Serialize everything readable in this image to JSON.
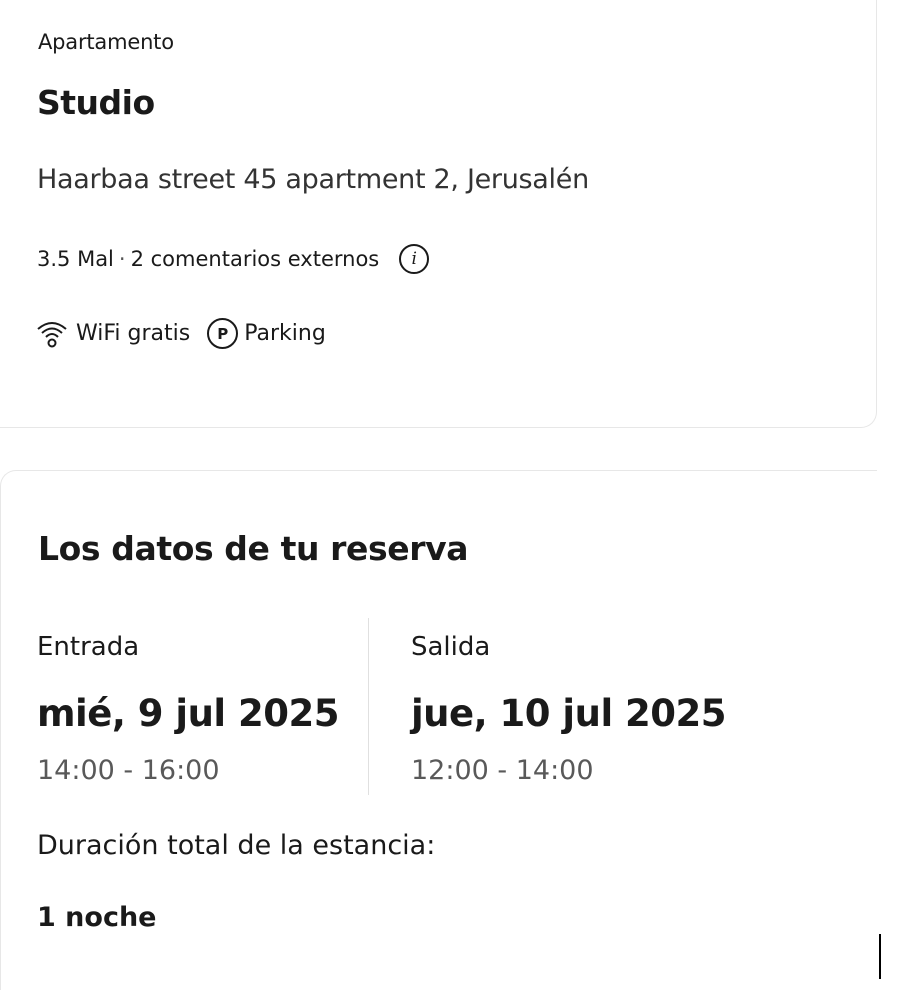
{
  "property": {
    "type": "Apartamento",
    "name": "Studio",
    "address": "Haarbaa street 45 apartment 2, Jerusalén",
    "rating": "3.5 Mal",
    "separator": "·",
    "reviews": "2 comentarios externos",
    "info_icon": "i",
    "facilities": [
      {
        "icon": "wifi-icon",
        "label": "WiFi gratis"
      },
      {
        "icon": "parking-icon",
        "glyph": "P",
        "label": "Parking"
      }
    ]
  },
  "booking": {
    "title": "Los datos de tu reserva",
    "checkin": {
      "label": "Entrada",
      "date": "mié, 9 jul 2025",
      "time": "14:00 - 16:00"
    },
    "checkout": {
      "label": "Salida",
      "date": "jue, 10 jul 2025",
      "time": "12:00 - 14:00"
    },
    "duration_label": "Duración total de la estancia:",
    "duration_value": "1 noche"
  }
}
